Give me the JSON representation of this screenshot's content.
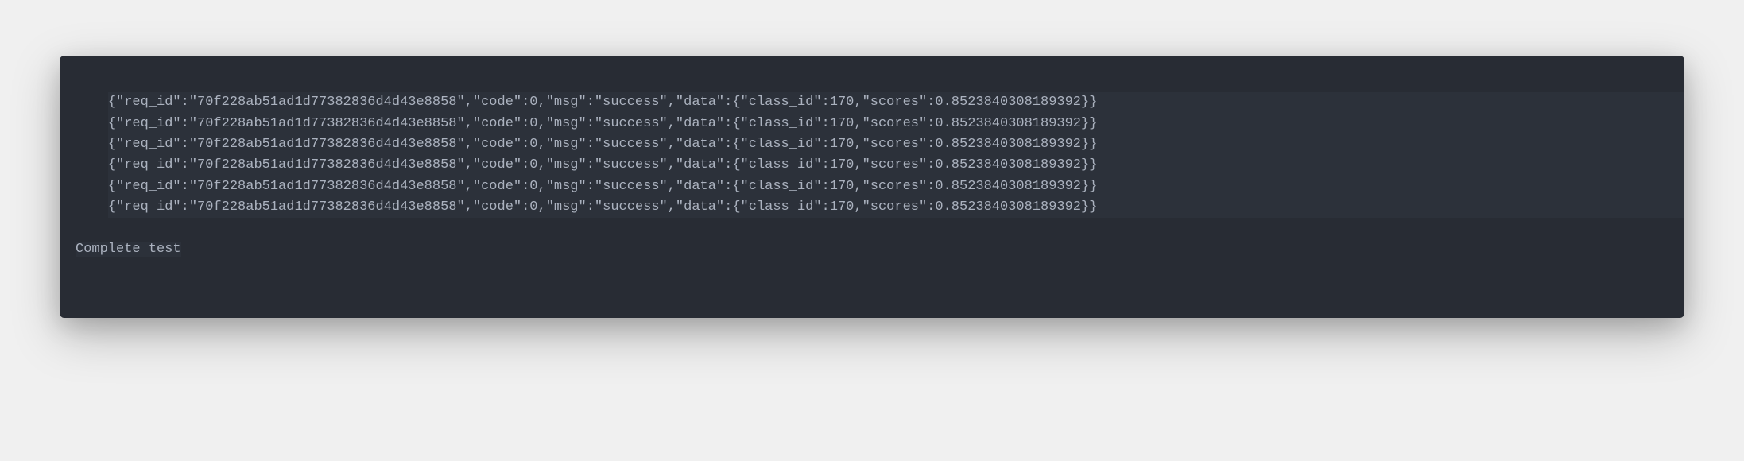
{
  "terminal": {
    "lines": [
      "{\"req_id\":\"70f228ab51ad1d77382836d4d43e8858\",\"code\":0,\"msg\":\"success\",\"data\":{\"class_id\":170,\"scores\":0.8523840308189392}}",
      "{\"req_id\":\"70f228ab51ad1d77382836d4d43e8858\",\"code\":0,\"msg\":\"success\",\"data\":{\"class_id\":170,\"scores\":0.8523840308189392}}",
      "{\"req_id\":\"70f228ab51ad1d77382836d4d43e8858\",\"code\":0,\"msg\":\"success\",\"data\":{\"class_id\":170,\"scores\":0.8523840308189392}}",
      "{\"req_id\":\"70f228ab51ad1d77382836d4d43e8858\",\"code\":0,\"msg\":\"success\",\"data\":{\"class_id\":170,\"scores\":0.8523840308189392}}",
      "{\"req_id\":\"70f228ab51ad1d77382836d4d43e8858\",\"code\":0,\"msg\":\"success\",\"data\":{\"class_id\":170,\"scores\":0.8523840308189392}}",
      "{\"req_id\":\"70f228ab51ad1d77382836d4d43e8858\",\"code\":0,\"msg\":\"success\",\"data\":{\"class_id\":170,\"scores\":0.8523840308189392}}",
      "Complete test"
    ]
  }
}
